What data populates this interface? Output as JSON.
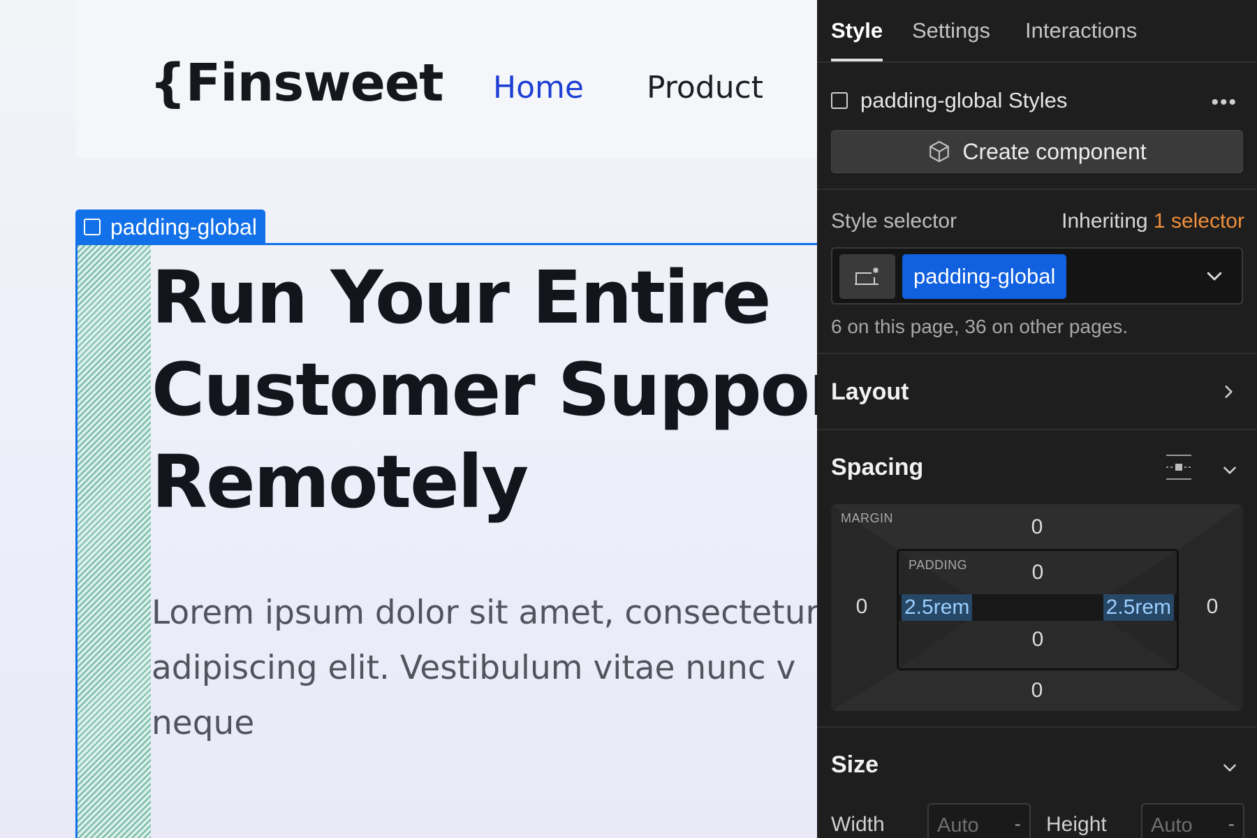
{
  "canvas": {
    "logo": "{Finsweet",
    "nav": {
      "home": "Home",
      "product": "Product"
    },
    "selected_element_label": "padding-global",
    "hero_title": "Run Your Entire\nCustomer Support\nRemotely",
    "hero_text": "Lorem ipsum dolor sit amet, consectetur\nadipiscing elit. Vestibulum vitae nunc v\nneque"
  },
  "panel": {
    "tabs": {
      "style": "Style",
      "settings": "Settings",
      "interactions": "Interactions"
    },
    "styles_label": "padding-global Styles",
    "create_component": "Create component",
    "style_selector": {
      "label": "Style selector",
      "inheriting_prefix": "Inheriting",
      "inheriting_count": "1 selector",
      "class_name": "padding-global",
      "usage": "6 on this page, 36 on other pages."
    },
    "layout": {
      "title": "Layout"
    },
    "spacing": {
      "title": "Spacing",
      "margin_label": "MARGIN",
      "padding_label": "PADDING",
      "margin": {
        "top": "0",
        "right": "0",
        "bottom": "0",
        "left": "0"
      },
      "padding": {
        "top": "0",
        "right": "2.5rem",
        "bottom": "0",
        "left": "2.5rem"
      }
    },
    "size": {
      "title": "Size",
      "width_label": "Width",
      "height_label": "Height",
      "width_placeholder": "Auto",
      "height_placeholder": "Auto",
      "width_unit": "-",
      "height_unit": "-"
    }
  },
  "colors": {
    "selection_blue": "#1270e8",
    "nav_active": "#1d3fd4",
    "panel_bg": "#1e1e1e",
    "accent_orange": "#f08f3c",
    "padding_highlight": "#9bcfff"
  }
}
